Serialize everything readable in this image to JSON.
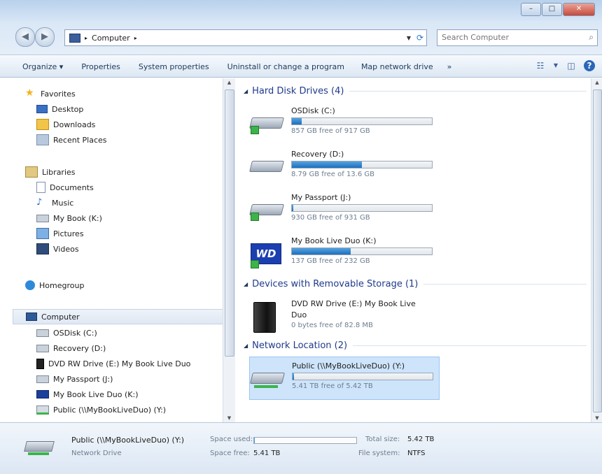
{
  "address": {
    "location": "Computer"
  },
  "search": {
    "placeholder": "Search Computer"
  },
  "toolbar": {
    "organize": "Organize ▾",
    "properties": "Properties",
    "system_properties": "System properties",
    "uninstall": "Uninstall or change a program",
    "map_network": "Map network drive",
    "more": "»"
  },
  "nav": {
    "favorites": "Favorites",
    "desktop": "Desktop",
    "downloads": "Downloads",
    "recent": "Recent Places",
    "libraries": "Libraries",
    "documents": "Documents",
    "music": "Music",
    "mybook": "My Book (K:)",
    "pictures": "Pictures",
    "videos": "Videos",
    "homegroup": "Homegroup",
    "computer": "Computer",
    "osdisk": "OSDisk (C:)",
    "recovery": "Recovery (D:)",
    "dvd": "DVD RW Drive (E:) My Book Live Duo",
    "passport": "My Passport (J:)",
    "mybookduo": "My Book Live Duo (K:)",
    "public": "Public (\\\\MyBookLiveDuo) (Y:)"
  },
  "groups": {
    "hdd": "Hard Disk Drives (4)",
    "removable": "Devices with Removable Storage (1)",
    "network": "Network Location (2)"
  },
  "drives": [
    {
      "name": "OSDisk (C:)",
      "free": "857 GB free of 917 GB",
      "used_fraction": 0.07
    },
    {
      "name": "Recovery (D:)",
      "free": "8.79 GB free of 13.6 GB",
      "used_fraction": 0.5
    },
    {
      "name": "My Passport (J:)",
      "free": "930 GB free of 931 GB",
      "used_fraction": 0.01
    },
    {
      "name": "My Book Live Duo (K:)",
      "free": "137 GB free of 232 GB",
      "used_fraction": 0.42
    }
  ],
  "removable": {
    "name_line1": "DVD RW Drive (E:) My Book Live",
    "name_line2": "Duo",
    "free": "0 bytes free of 82.8 MB"
  },
  "network_drive": {
    "name": "Public (\\\\MyBookLiveDuo) (Y:)",
    "free": "5.41 TB free of 5.42 TB",
    "used_fraction": 0.01
  },
  "details": {
    "name": "Public (\\\\MyBookLiveDuo) (Y:)",
    "type": "Network Drive",
    "space_used_label": "Space used:",
    "space_free_label": "Space free:",
    "space_free": "5.41 TB",
    "total_size_label": "Total size:",
    "total_size": "5.42 TB",
    "filesystem_label": "File system:",
    "filesystem": "NTFS",
    "used_fraction": 0.01
  },
  "colors": {
    "accent": "#1b6fbd",
    "group_title": "#1e3a8c",
    "selection": "#cde4fb"
  }
}
